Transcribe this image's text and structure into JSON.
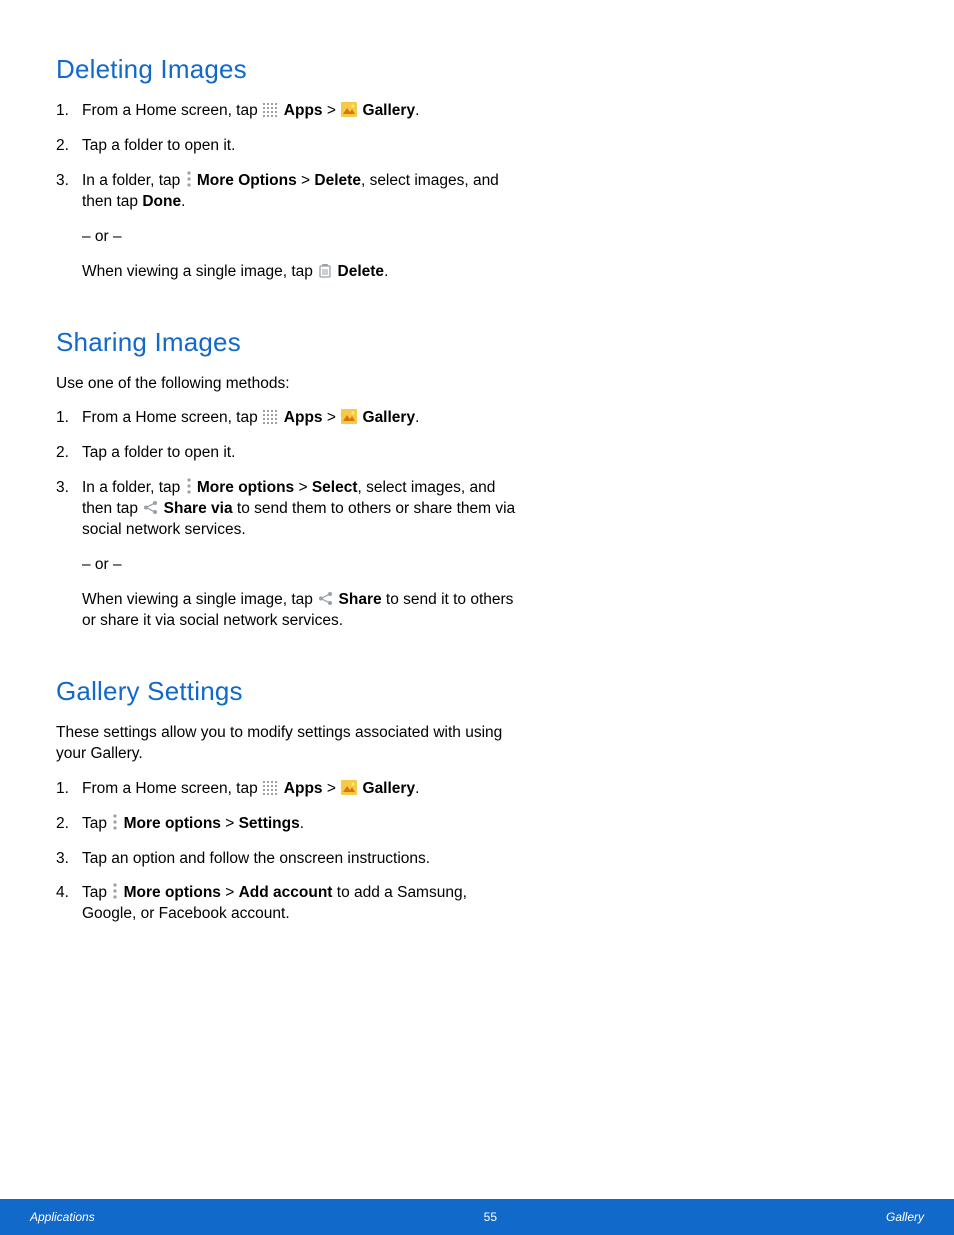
{
  "sections": {
    "deleting": {
      "heading": "Deleting Images",
      "step1_a": "From a Home screen, tap ",
      "step1_b": " Apps",
      "step1_c": " > ",
      "step1_d": " Gallery",
      "step2": "Tap a folder to open it.",
      "step3_a": "In a folder, tap ",
      "step3_b": " More Options",
      "step3_c": " > ",
      "step3_d": "Delete",
      "step3_e": ", select images, and then tap ",
      "step3_f": "Done",
      "or": "– or –",
      "step3_g": "When viewing a single image, tap ",
      "step3_h": " Delete"
    },
    "sharing": {
      "heading": "Sharing Images",
      "intro": "Use one of the following methods:",
      "step1_a": "From a Home screen, tap ",
      "step1_b": " Apps",
      "step1_c": " > ",
      "step1_d": " Gallery",
      "step2": "Tap a folder to open it.",
      "step3_a": "In a folder, tap ",
      "step3_b": " More options",
      "step3_c": " > ",
      "step3_d": "Select",
      "step3_e": ", select images, and then tap ",
      "step3_f": " Share via",
      "step3_g": " to send them to others or share them via social network services.",
      "or": "– or –",
      "step3_h": "When viewing a single image, tap ",
      "step3_i": " Share",
      "step3_j": " to send it to others or share it via social network services."
    },
    "settings": {
      "heading": "Gallery Settings",
      "intro": "These settings allow you to modify settings associated with using your Gallery.",
      "step1_a": "From a Home screen, tap ",
      "step1_b": " Apps",
      "step1_c": " > ",
      "step1_d": " Gallery",
      "step2_a": "Tap ",
      "step2_b": " More options",
      "step2_c": " > ",
      "step2_d": "Settings",
      "step3": "Tap an option and follow the onscreen instructions.",
      "step4_a": "Tap ",
      "step4_b": " More options",
      "step4_c": " > ",
      "step4_d": "Add account",
      "step4_e": " to add a Samsung, Google, or Facebook account."
    }
  },
  "footer": {
    "left": "Applications",
    "center": "55",
    "right": "Gallery"
  }
}
